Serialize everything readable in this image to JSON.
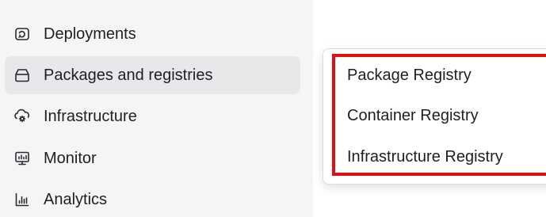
{
  "sidebar": {
    "items": [
      {
        "label": "Deployments",
        "icon": "deployments-icon"
      },
      {
        "label": "Packages and registries",
        "icon": "package-icon",
        "active": true
      },
      {
        "label": "Infrastructure",
        "icon": "infrastructure-icon"
      },
      {
        "label": "Monitor",
        "icon": "monitor-icon"
      },
      {
        "label": "Analytics",
        "icon": "analytics-icon"
      }
    ]
  },
  "submenu": {
    "items": [
      {
        "label": "Package Registry"
      },
      {
        "label": "Container Registry"
      },
      {
        "label": "Infrastructure Registry"
      }
    ]
  },
  "colors": {
    "highlight": "#e01010",
    "active_bg": "#e8e8eb",
    "sidebar_bg": "#f5f5f6",
    "text": "#1f1e24"
  }
}
